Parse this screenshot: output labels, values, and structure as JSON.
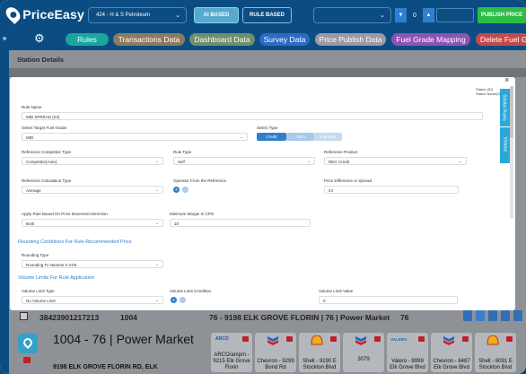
{
  "app": {
    "name": "PriceEasy"
  },
  "topbar": {
    "station": "424 - H & S Petroleum",
    "ai_based_label": "AI BASED",
    "rule_based_label": "RULE BASED",
    "stepper_value": "0",
    "publish_label": "PUBLISH PRICE"
  },
  "tabs": [
    {
      "label": "Rules",
      "color": "#1aa59e"
    },
    {
      "label": "Transactions Data",
      "color": "#8d7b5f"
    },
    {
      "label": "Dashboard Data",
      "color": "#6f8f6a"
    },
    {
      "label": "Survey Data",
      "color": "#2d6ac4"
    },
    {
      "label": "Price Publish Data",
      "color": "#9b9aa3"
    },
    {
      "label": "Fuel Grade Mapping",
      "color": "#8e53b3"
    },
    {
      "label": "Delete Fuel Gra",
      "color": "#c44a4a"
    }
  ],
  "page": {
    "section_title": "Station Details"
  },
  "modal": {
    "status_line1": "Status (ID)",
    "status_line2": "Status Name(ID)",
    "close_icon": "×",
    "side_tabs": [
      "Similar Rules",
      "Volume"
    ],
    "rule_name": {
      "label": "Rule Name",
      "value": "MID SPREAD (23)"
    },
    "target_fuel_grade": {
      "label": "Select Target Fuel Grade",
      "value": "MID"
    },
    "select_type": {
      "label": "Select Type",
      "options": [
        "Credit",
        "Cash",
        "Liquidity"
      ]
    },
    "ref_competitor_type": {
      "label": "Reference Competitor Type",
      "value": "Competitor(Auto)"
    },
    "rule_type": {
      "label": "Rule Type",
      "value": "Self"
    },
    "ref_product": {
      "label": "Reference Product",
      "value": "REG Credit"
    },
    "ref_calc_type": {
      "label": "Reference Calculation Type",
      "value": "Average"
    },
    "operator_label": "Operator From the Reference",
    "price_diff": {
      "label": "Price Difference or Spread",
      "value": "24"
    },
    "apply_rule": {
      "label": "Apply Rule Based On Price Movement Direction",
      "value": "Both"
    },
    "min_margin": {
      "label": "Minimum Margin In CPG",
      "value": "10"
    },
    "rounding_section": "Rounding Conditions For Rule Recommended Price",
    "rounding_type": {
      "label": "Rounding Type",
      "value": "Rounding To Nearest X.XX9"
    },
    "volume_section": "Volume Limits For Rule Application",
    "volume_limit_type": {
      "label": "Volume Limit Type",
      "value": "No Volume Limit"
    },
    "volume_condition_label": "Volume Limit Condition",
    "volume_limit_value": {
      "label": "Volume Limit Value",
      "value": "0"
    }
  },
  "table_row": {
    "col1": "38423901217213",
    "col2": "1004",
    "col3": "76 - 9198 ELK GROVE FLORIN | 76 | Power Market",
    "col4": "76"
  },
  "station": {
    "name": "1004 - 76 | Power Market",
    "address": "9198 ELK GROVE FLORIN RD, ELK"
  },
  "competitors": [
    {
      "label": "ARCO/ampm - 9215 Elk Grove Florin",
      "brand": "ARCO",
      "color": "#1f4fa3"
    },
    {
      "label": "Chevron - 9299 Bond Rd",
      "brand": "chevron",
      "color": "#1d64c1"
    },
    {
      "label": "Shell - 9190 E Stockton Blvd",
      "brand": "shell",
      "color": "#e8b21a"
    },
    {
      "label": "3079",
      "brand": "chevron",
      "color": "#1d64c1"
    },
    {
      "label": "Valero - 8999 Elk Grove Blvd",
      "brand": "VALERO",
      "color": "#1f6fb3"
    },
    {
      "label": "Chevron - 8487 Elk Grove Blvd",
      "brand": "chevron",
      "color": "#1d64c1"
    },
    {
      "label": "Shell - 8091 E Stockton Blvd",
      "brand": "shell",
      "color": "#e8b21a"
    }
  ]
}
